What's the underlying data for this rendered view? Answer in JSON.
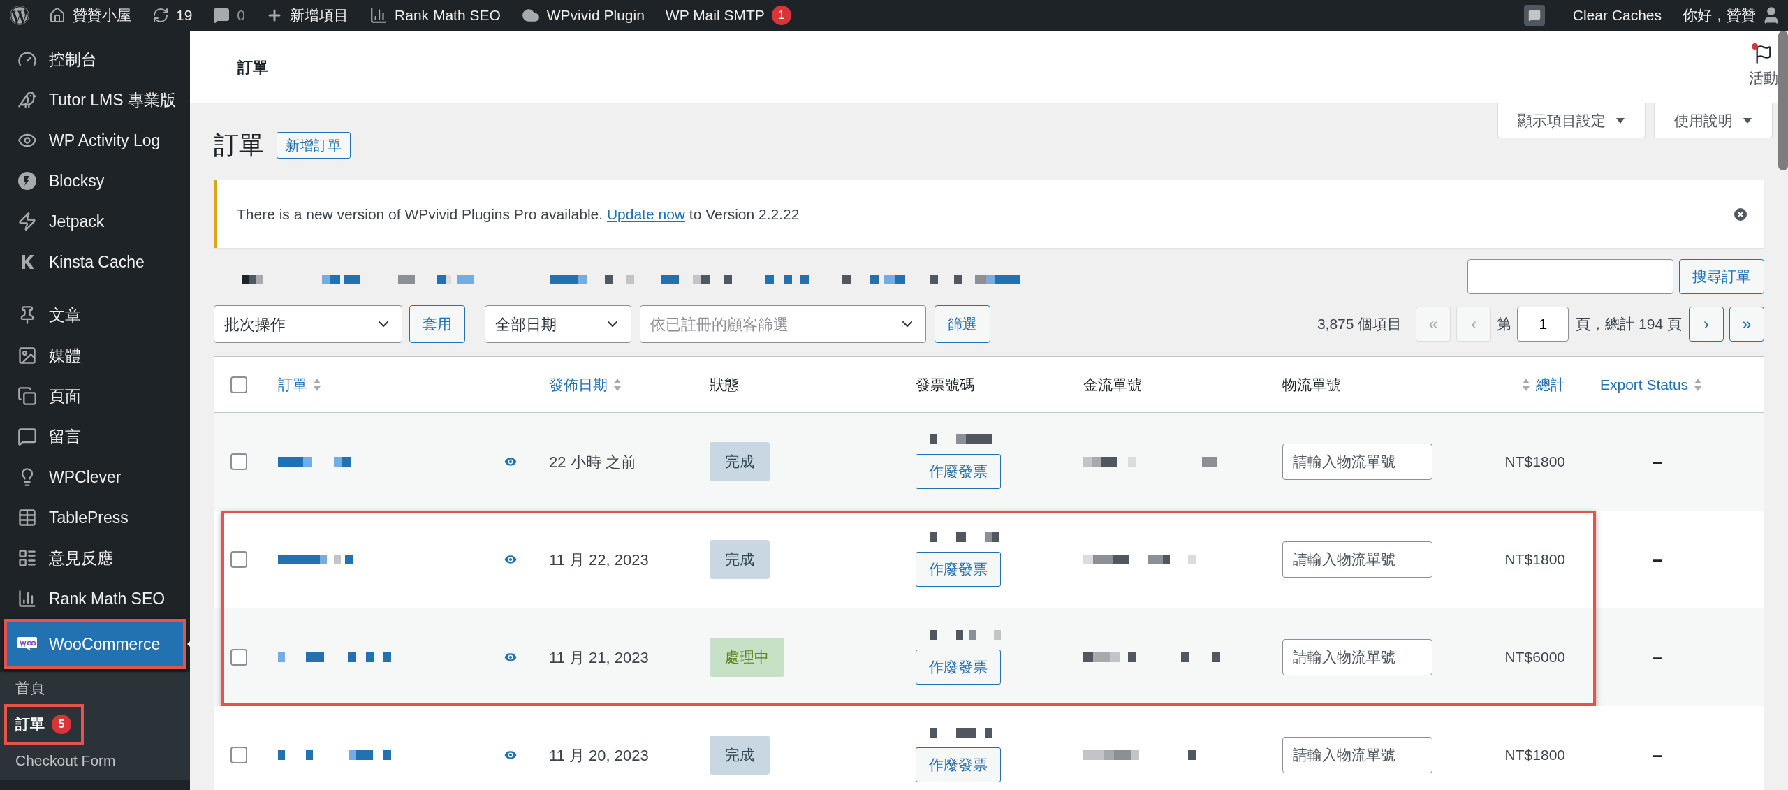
{
  "admin_bar": {
    "site_name": "贊贊小屋",
    "updates": "19",
    "comments": "0",
    "new_item": "新增項目",
    "plugins": [
      {
        "label": "Rank Math SEO"
      },
      {
        "label": "WPvivid Plugin"
      },
      {
        "label": "WP Mail SMTP",
        "badge": "1"
      }
    ],
    "clear_caches": "Clear Caches",
    "greeting": "你好，贊贊"
  },
  "sidebar": {
    "sections": [
      {
        "items": [
          {
            "label": "控制台",
            "selected": false,
            "highlighted": false
          },
          {
            "label": "Tutor LMS 專業版",
            "selected": false,
            "highlighted": false
          },
          {
            "label": "WP Activity Log",
            "selected": false,
            "highlighted": false
          },
          {
            "label": "Blocksy",
            "selected": false,
            "highlighted": false
          },
          {
            "label": "Jetpack",
            "selected": false,
            "highlighted": false
          },
          {
            "label": "Kinsta Cache",
            "selected": false,
            "highlighted": false
          }
        ]
      },
      {
        "items": [
          {
            "label": "文章",
            "selected": false,
            "highlighted": false
          },
          {
            "label": "媒體",
            "selected": false,
            "highlighted": false
          },
          {
            "label": "頁面",
            "selected": false,
            "highlighted": false
          },
          {
            "label": "留言",
            "selected": false,
            "highlighted": false
          },
          {
            "label": "WPClever",
            "selected": false,
            "highlighted": false
          },
          {
            "label": "TablePress",
            "selected": false,
            "highlighted": false
          },
          {
            "label": "意見反應",
            "selected": false,
            "highlighted": false
          },
          {
            "label": "Rank Math SEO",
            "selected": false,
            "highlighted": false
          },
          {
            "label": "WooCommerce",
            "selected": true,
            "highlighted": true,
            "children": [
              {
                "label": "首頁",
                "selected": false,
                "highlighted": false
              },
              {
                "label": "訂單",
                "selected": true,
                "highlighted": true,
                "badge": "5"
              },
              {
                "label": "Checkout Form",
                "selected": false,
                "highlighted": false
              }
            ]
          }
        ]
      }
    ]
  },
  "header": {
    "title": "訂單",
    "activity": "活動",
    "activity_unread": true
  },
  "screen_tabs": [
    {
      "label": "顯示項目設定"
    },
    {
      "label": "使用說明"
    }
  ],
  "page": {
    "title": "訂單",
    "add_new": "新增訂單"
  },
  "notice": {
    "text": "There is a new version of WPvivid Plugins Pro available. ",
    "link": "Update now",
    "after": " to Version 2.2.22"
  },
  "search": {
    "button": "搜尋訂單"
  },
  "filters": {
    "bulk": "批次操作",
    "apply": "套用",
    "dates": "全部日期",
    "customer_placeholder": "依已註冊的顧客篩選",
    "filter": "篩選"
  },
  "pagination": {
    "count": "3,875 個項目",
    "first": {
      "label": "«",
      "disabled": true
    },
    "prev": {
      "label": "‹",
      "disabled": true
    },
    "page_label": "第",
    "current": "1",
    "total": "頁，總計 194 頁",
    "next": {
      "label": "›",
      "disabled": false
    },
    "last": {
      "label": "»",
      "disabled": false
    }
  },
  "table": {
    "select_all_checked": false,
    "columns": [
      {
        "label": "訂單",
        "sortable": true
      },
      {
        "label": "發佈日期",
        "sortable": true
      },
      {
        "label": "狀態",
        "sortable": false
      },
      {
        "label": "發票號碼",
        "sortable": false
      },
      {
        "label": "金流單號",
        "sortable": false
      },
      {
        "label": "物流單號",
        "sortable": false
      },
      {
        "label": "總計",
        "sortable": true
      },
      {
        "label": "Export Status",
        "sortable": true
      }
    ],
    "rows": [
      {
        "checked": false,
        "highlighted": false,
        "date": "22 小時 之前",
        "status": {
          "label": "完成",
          "kind": "completed"
        },
        "void_button": "作廢發票",
        "tracking_placeholder": "請輸入物流單號",
        "total": "NT$1800",
        "export_status": "–"
      },
      {
        "checked": false,
        "highlighted": true,
        "date": "11 月 22, 2023",
        "status": {
          "label": "完成",
          "kind": "completed"
        },
        "void_button": "作廢發票",
        "tracking_placeholder": "請輸入物流單號",
        "total": "NT$1800",
        "export_status": "–"
      },
      {
        "checked": false,
        "highlighted": true,
        "date": "11 月 21, 2023",
        "status": {
          "label": "處理中",
          "kind": "processing"
        },
        "void_button": "作廢發票",
        "tracking_placeholder": "請輸入物流單號",
        "total": "NT$6000",
        "export_status": "–"
      },
      {
        "checked": false,
        "highlighted": false,
        "date": "11 月 20, 2023",
        "status": {
          "label": "完成",
          "kind": "completed"
        },
        "void_button": "作廢發票",
        "tracking_placeholder": "請輸入物流單號",
        "total": "NT$1800",
        "export_status": "–"
      }
    ]
  }
}
